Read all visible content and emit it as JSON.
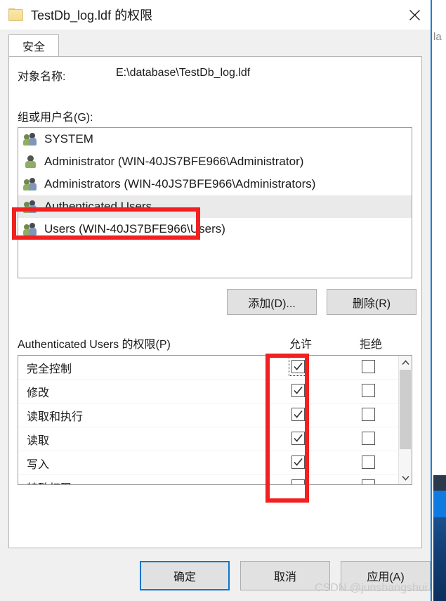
{
  "window": {
    "title": "TestDb_log.ldf 的权限",
    "icon": "folder-icon",
    "close_label": "✕"
  },
  "tabs": [
    {
      "label": "安全",
      "active": true
    }
  ],
  "object": {
    "name_label": "对象名称:",
    "name_value": "E:\\database\\TestDb_log.ldf"
  },
  "groups": {
    "label": "组或用户名(G):",
    "items": [
      {
        "name": "SYSTEM",
        "icon": "group-icon",
        "selected": false
      },
      {
        "name": "Administrator (WIN-40JS7BFE966\\Administrator)",
        "icon": "user-icon",
        "selected": false
      },
      {
        "name": "Administrators (WIN-40JS7BFE966\\Administrators)",
        "icon": "group-icon",
        "selected": false
      },
      {
        "name": "Authenticated Users",
        "icon": "group-icon",
        "selected": true
      },
      {
        "name": "Users (WIN-40JS7BFE966\\Users)",
        "icon": "group-icon",
        "selected": false
      }
    ],
    "add_button": "添加(D)...",
    "remove_button": "删除(R)"
  },
  "permissions": {
    "title": "Authenticated Users 的权限(P)",
    "column_allow": "允许",
    "column_deny": "拒绝",
    "rows": [
      {
        "name": "完全控制",
        "allow": true,
        "deny": false,
        "focused": true
      },
      {
        "name": "修改",
        "allow": true,
        "deny": false,
        "focused": false
      },
      {
        "name": "读取和执行",
        "allow": true,
        "deny": false,
        "focused": false
      },
      {
        "name": "读取",
        "allow": true,
        "deny": false,
        "focused": false
      },
      {
        "name": "写入",
        "allow": true,
        "deny": false,
        "focused": false
      },
      {
        "name": "特殊权限",
        "allow": false,
        "deny": false,
        "focused": false
      }
    ]
  },
  "footer": {
    "ok": "确定",
    "cancel": "取消",
    "apply": "应用(A)"
  },
  "annotations": {
    "highlight_user": "Authenticated Users",
    "highlight_column": "允许",
    "color": "#f22020"
  },
  "watermark": "CSDN @junshangshui",
  "background_window": {
    "text": "la",
    "border_color": "#1a7fd4"
  }
}
